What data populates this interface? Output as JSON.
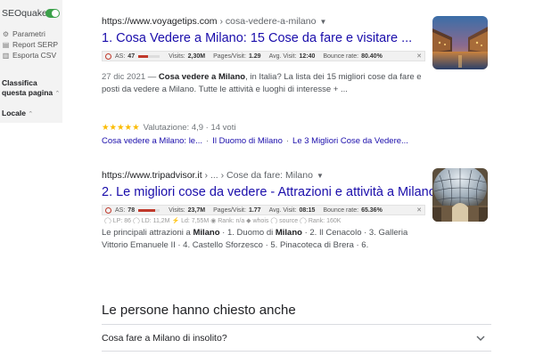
{
  "seoquake": {
    "title": "SEOquake",
    "toggle_on": true,
    "menu": [
      {
        "icon": "gear-icon",
        "glyph": "⚙",
        "label": "Parametri"
      },
      {
        "icon": "report-icon",
        "glyph": "▤",
        "label": "Report SERP"
      },
      {
        "icon": "export-icon",
        "glyph": "▥",
        "label": "Esporta CSV"
      }
    ],
    "classify_label_1": "Classifica",
    "classify_label_2": "questa pagina",
    "locale_label": "Locale"
  },
  "results": [
    {
      "domain": "https://www.voyagetips.com",
      "path": " › cosa-vedere-a-milano",
      "title": "1. Cosa Vedere a Milano: 15 Cose da fare e visitare ...",
      "seo": {
        "as_label": "AS:",
        "as_value": "47",
        "as_fill": 0.47,
        "visits_label": "Visits:",
        "visits": "2,30M",
        "pv_label": "Pages/Visit:",
        "pages_visit": "1.29",
        "avg_label": "Avg. Visit:",
        "avg_visit": "12:40",
        "bounce_label": "Bounce rate:",
        "bounce": "80.40%"
      },
      "date": "27 dic 2021",
      "snippet_parts": [
        " — ",
        "Cosa vedere a Milano",
        ", in Italia? La lista dei 15 migliori cose da fare e posti da vedere a Milano. Tutte le attività e luoghi di interesse + ..."
      ],
      "stars": "★★★★★",
      "rating_text": "Valutazione: 4,9 · 14 voti",
      "sitelinks": [
        "Cosa vedere a Milano: le...",
        "Il Duomo di Milano",
        "Le 3 Migliori Cose da Vedere..."
      ]
    },
    {
      "domain": "https://www.tripadvisor.it",
      "path": " › ... › Cose da fare: Milano",
      "title": "2. Le migliori cose da vedere - Attrazioni e attività a Milano",
      "seo": {
        "as_label": "AS:",
        "as_value": "78",
        "as_fill": 0.78,
        "visits_label": "Visits:",
        "visits": "23,7M",
        "pv_label": "Pages/Visit:",
        "pages_visit": "1.77",
        "avg_label": "Avg. Visit:",
        "avg_visit": "08:15",
        "bounce_label": "Bounce rate:",
        "bounce": "65.36%"
      },
      "seo_row2": "◯ LP: 86   ◯ LD: 11,2M   ⚡ Ld: 7,55M   ◉ Rank: n/a   ◆ whois   ◯ source   ◯ Rank: 160K",
      "snippet_html_parts": [
        "Le principali attrazioni a ",
        "Milano",
        " · 1. Duomo di ",
        "Milano",
        " · 2. Il Cenacolo · 3. Galleria Vittorio Emanuele II · 4. Castello Sforzesco · 5. Pinacoteca di Brera · 6."
      ]
    }
  ],
  "paa": {
    "title": "Le persone hanno chiesto anche",
    "questions": [
      "Cosa fare a Milano di insolito?"
    ]
  },
  "colors": {
    "link": "#1a0dab",
    "toggle": "#3ba14a",
    "star": "#fbbc04",
    "meter": "#c0392b"
  }
}
